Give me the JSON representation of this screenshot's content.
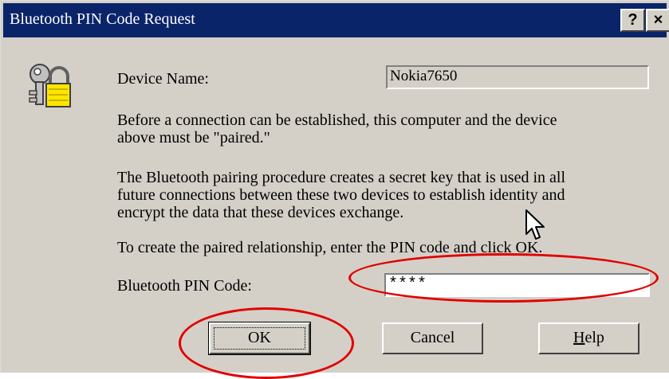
{
  "dialog": {
    "title": "Bluetooth PIN Code Request",
    "help_glyph": "?",
    "close_glyph": "×",
    "icon": "lock-key-icon"
  },
  "device": {
    "label": "Device Name:",
    "value": "Nokia7650"
  },
  "text": {
    "para1_line1": "Before a connection can be established, this computer and the device",
    "para1_line2": "above must be \"paired.\"",
    "para2_line1": "The Bluetooth pairing procedure creates a secret key that is used in all",
    "para2_line2": "future connections between these two devices to establish identity and",
    "para2_line3": "encrypt the data that these devices exchange.",
    "para3": "To create the paired relationship, enter the PIN code and click OK."
  },
  "pin": {
    "label": "Bluetooth PIN Code:",
    "value": "****"
  },
  "buttons": {
    "ok": "OK",
    "cancel": "Cancel",
    "help_pre": "",
    "help_mnemonic": "H",
    "help_post": "elp"
  },
  "colors": {
    "titlebar": "#0a246a",
    "face": "#d4d0c8",
    "annotation": "#e00000"
  }
}
